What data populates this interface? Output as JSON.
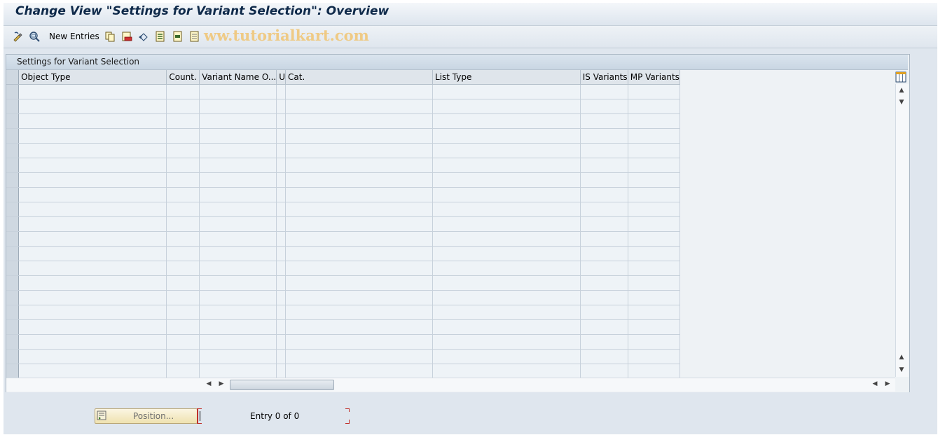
{
  "window": {
    "title": "Change View \"Settings for Variant Selection\": Overview"
  },
  "toolbar": {
    "items": [
      {
        "name": "display-change-icon",
        "interactable": true
      },
      {
        "name": "other-view-icon",
        "interactable": true
      }
    ],
    "new_entries_label": "New Entries",
    "more_icons": [
      "copy-as-icon",
      "delete-icon",
      "undo-change-icon",
      "select-all-icon",
      "select-block-icon",
      "deselect-all-icon"
    ],
    "watermark": "ww.tutorialkart.com"
  },
  "panel": {
    "title": "Settings for Variant Selection",
    "columns": [
      {
        "label": "Object Type"
      },
      {
        "label": "Count."
      },
      {
        "label": "Variant Name O..."
      },
      {
        "label": "U"
      },
      {
        "label": "Cat."
      },
      {
        "label": "List Type"
      },
      {
        "label": "IS Variants"
      },
      {
        "label": "MP Variants"
      }
    ],
    "row_count": 20
  },
  "footer": {
    "position_button_label": "Position...",
    "entry_text": "Entry 0 of 0"
  },
  "colors": {
    "title_text": "#0f2a4a",
    "panel_header": "#c9d6e3",
    "grid_cell": "#eef3f7",
    "watermark": "#f0c77a",
    "position_button": "#efe2b0",
    "required_bracket": "#c0302a"
  }
}
